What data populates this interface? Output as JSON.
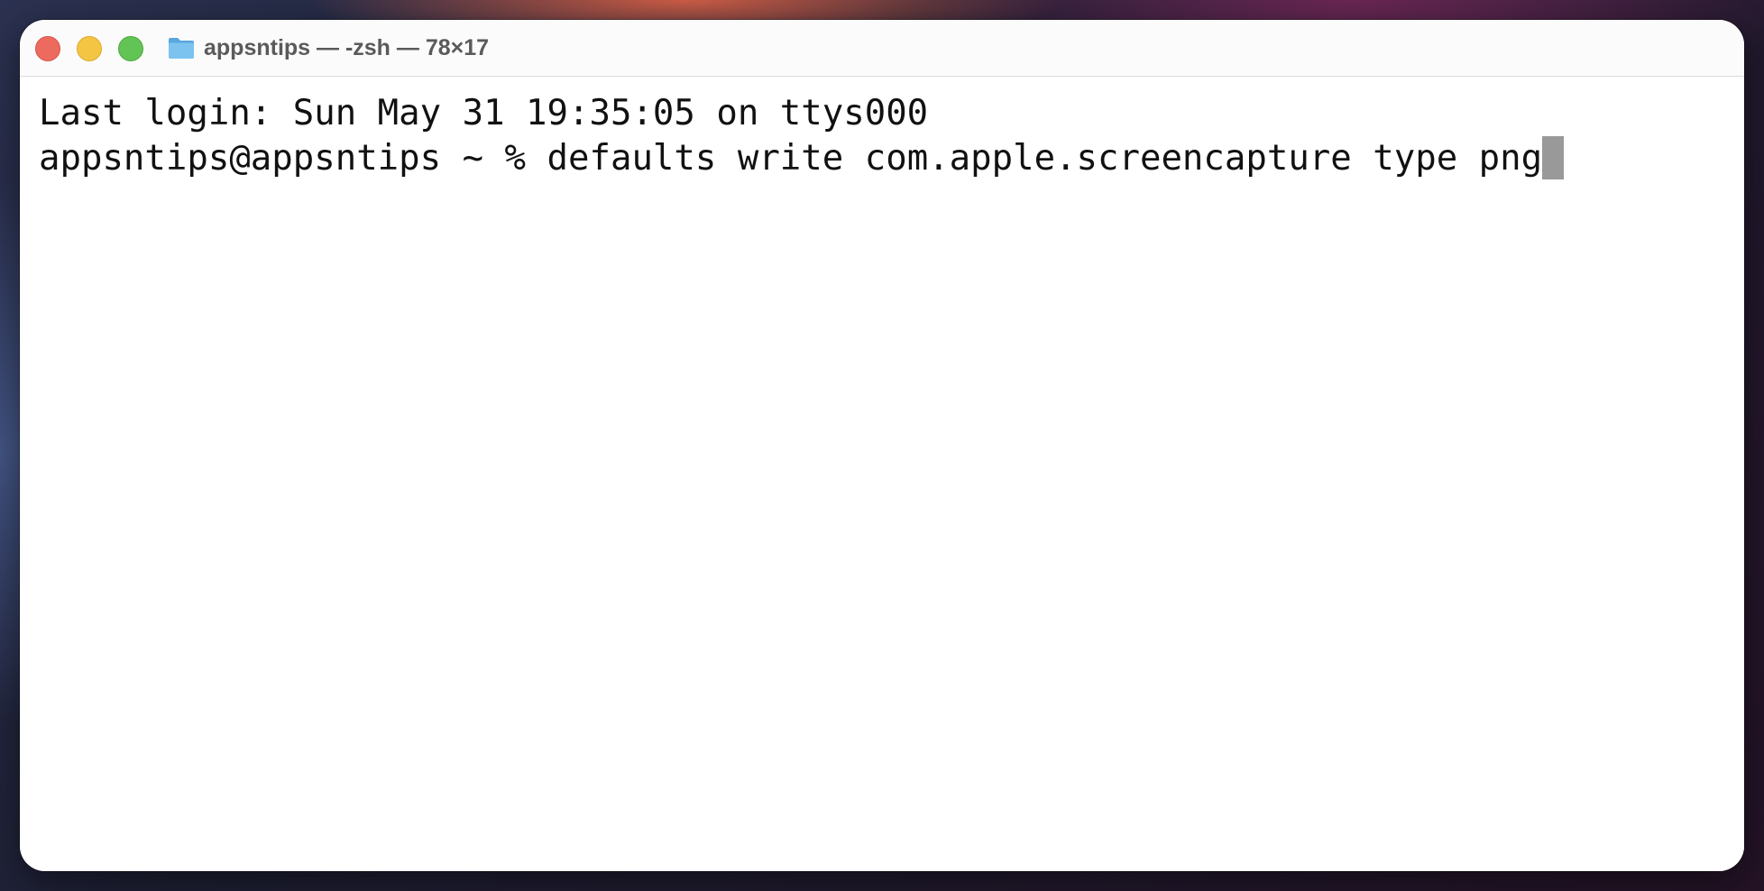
{
  "window": {
    "title": "appsntips — -zsh — 78×17"
  },
  "terminal": {
    "last_login": "Last login: Sun May 31 19:35:05 on ttys000",
    "prompt": "appsntips@appsntips ~ % ",
    "command": "defaults write com.apple.screencapture type png"
  },
  "icons": {
    "title_icon": "folder-icon"
  },
  "colors": {
    "close": "#ed6a5e",
    "minimize": "#f4c542",
    "zoom": "#61c454",
    "cursor": "#999999",
    "folder": "#6cb6ea"
  }
}
